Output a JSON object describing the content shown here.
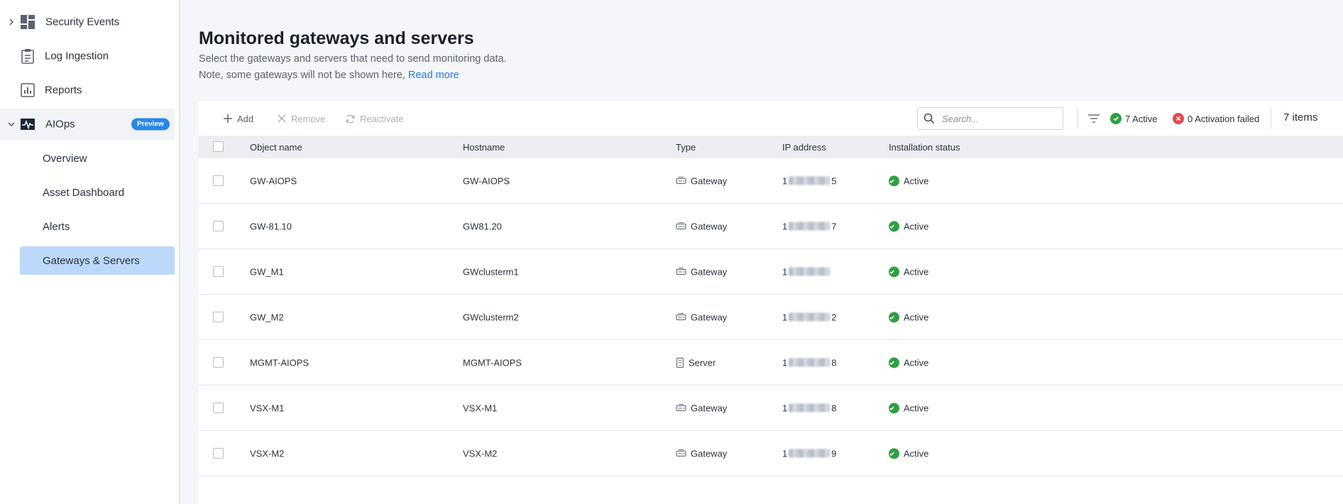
{
  "sidebar": {
    "items": [
      {
        "label": "Security Events"
      },
      {
        "label": "Log Ingestion"
      },
      {
        "label": "Reports"
      },
      {
        "label": "AIOps",
        "badge": "Preview"
      }
    ],
    "subitems": [
      {
        "label": "Overview"
      },
      {
        "label": "Asset Dashboard"
      },
      {
        "label": "Alerts"
      },
      {
        "label": "Gateways & Servers"
      }
    ]
  },
  "page": {
    "title": "Monitored gateways and servers",
    "description": "Select the gateways and servers that need to send monitoring data.",
    "note": "Note, some gateways will not be shown here,",
    "read_more": "Read more"
  },
  "toolbar": {
    "add": "Add",
    "remove": "Remove",
    "reactivate": "Reactivate",
    "search_placeholder": "Search...",
    "active_status": "7 Active",
    "failed_status": "0 Activation failed",
    "items_count": "7 items"
  },
  "colors": {
    "accent": "#2a86e6",
    "active_nav": "#bcd9fb",
    "success": "#2ea043",
    "error": "#e5484d"
  },
  "table": {
    "columns": [
      "Object name",
      "Hostname",
      "Type",
      "IP address",
      "Installation status"
    ],
    "rows": [
      {
        "name": "GW-AIOPS",
        "hostname": "GW-AIOPS",
        "type": "Gateway",
        "ip_prefix": "1",
        "ip_suffix": "5",
        "status": "Active"
      },
      {
        "name": "GW-81.10",
        "hostname": "GW81.20",
        "type": "Gateway",
        "ip_prefix": "1",
        "ip_suffix": "7",
        "status": "Active"
      },
      {
        "name": "GW_M1",
        "hostname": "GWclusterm1",
        "type": "Gateway",
        "ip_prefix": "1",
        "ip_suffix": "",
        "status": "Active"
      },
      {
        "name": "GW_M2",
        "hostname": "GWclusterm2",
        "type": "Gateway",
        "ip_prefix": "1",
        "ip_suffix": "2",
        "status": "Active"
      },
      {
        "name": "MGMT-AIOPS",
        "hostname": "MGMT-AIOPS",
        "type": "Server",
        "ip_prefix": "1",
        "ip_suffix": "8",
        "status": "Active"
      },
      {
        "name": "VSX-M1",
        "hostname": "VSX-M1",
        "type": "Gateway",
        "ip_prefix": "1",
        "ip_suffix": "8",
        "status": "Active"
      },
      {
        "name": "VSX-M2",
        "hostname": "VSX-M2",
        "type": "Gateway",
        "ip_prefix": "1",
        "ip_suffix": "9",
        "status": "Active"
      }
    ]
  }
}
